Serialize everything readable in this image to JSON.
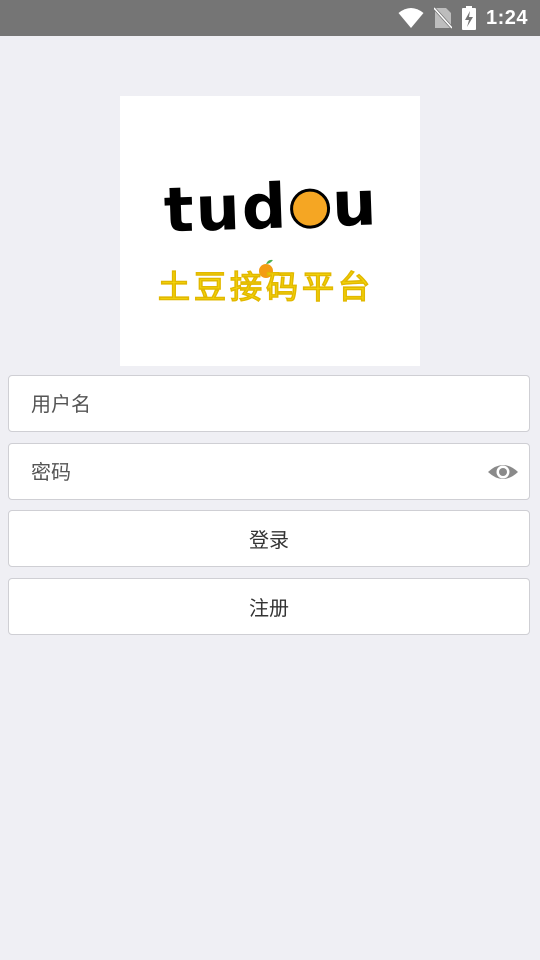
{
  "status_bar": {
    "time": "1:24",
    "icons": [
      "wifi-icon",
      "no-sim-icon",
      "battery-charging-icon"
    ]
  },
  "logo": {
    "word": "tudou",
    "word_prefix": "tud",
    "word_suffix": "u",
    "subtitle": "土豆接码平台",
    "icons": [
      "orange-face-icon",
      "small-orange-icon"
    ],
    "colors": {
      "word": "#000000",
      "subtitle": "#f5d90c",
      "orange": "#f5a623"
    }
  },
  "form": {
    "username": {
      "placeholder": "用户名",
      "value": ""
    },
    "password": {
      "placeholder": "密码",
      "value": "",
      "toggle_icon": "eye-icon"
    },
    "login_label": "登录",
    "register_label": "注册"
  },
  "colors": {
    "background": "#efeff4",
    "status_bar": "#757575"
  }
}
